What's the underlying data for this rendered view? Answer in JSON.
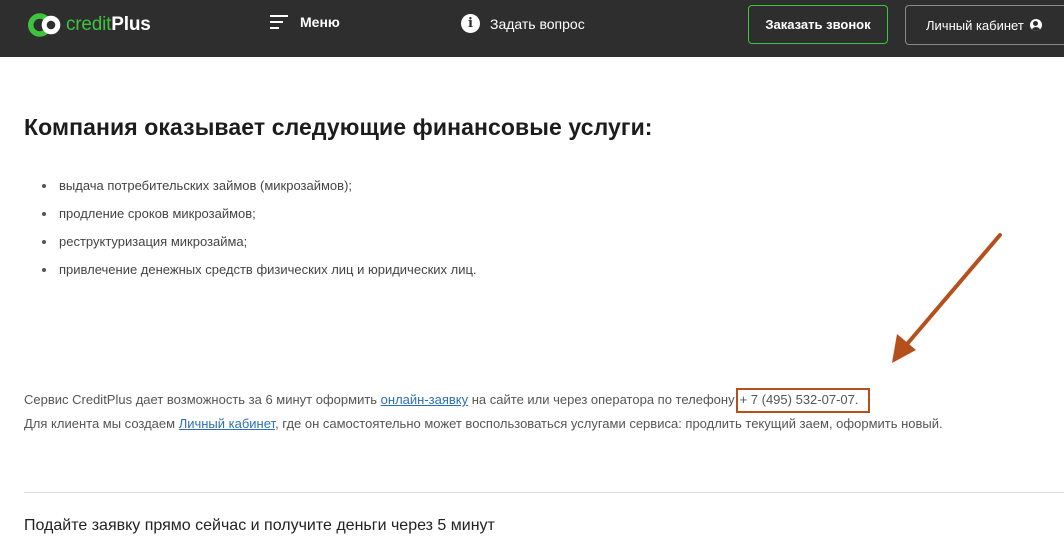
{
  "header": {
    "logo": {
      "credit": "credit",
      "plus": "Plus"
    },
    "menu_label": "Меню",
    "ask_label": "Задать вопрос",
    "call_button": "Заказать звонок",
    "cabinet_button": "Личный кабинет"
  },
  "main": {
    "title": "Компания оказывает следующие финансовые услуги:",
    "services": [
      "выдача потребительских займов (микрозаймов);",
      "продление сроков микрозаймов;",
      "реструктуризация микрозайма;",
      "привлечение денежных средств физических лиц и юридических лиц."
    ],
    "para1": {
      "before": "Сервис CreditPlus дает возможность за 6 минут оформить ",
      "link": "онлайн-заявку",
      "after": " на сайте или через оператора по телефону",
      "phone": "+ 7 (495) 532-07-07."
    },
    "para2": {
      "before": "Для клиента мы создаем ",
      "link": "Личный кабинет",
      "after": ", где он самостоятельно может воспользоваться услугами сервиса: продлить текущий заем, оформить новый."
    },
    "cta": "Подайте заявку прямо сейчас и получите деньги через 5 минут"
  },
  "colors": {
    "header_bg": "#2e2e2e",
    "brand_green": "#3ec33e",
    "link": "#2d6fb4",
    "annotation": "#b5501d"
  },
  "icons": [
    "logo-mark-icon",
    "hamburger-icon",
    "info-icon",
    "user-icon",
    "annotation-arrow-icon"
  ]
}
